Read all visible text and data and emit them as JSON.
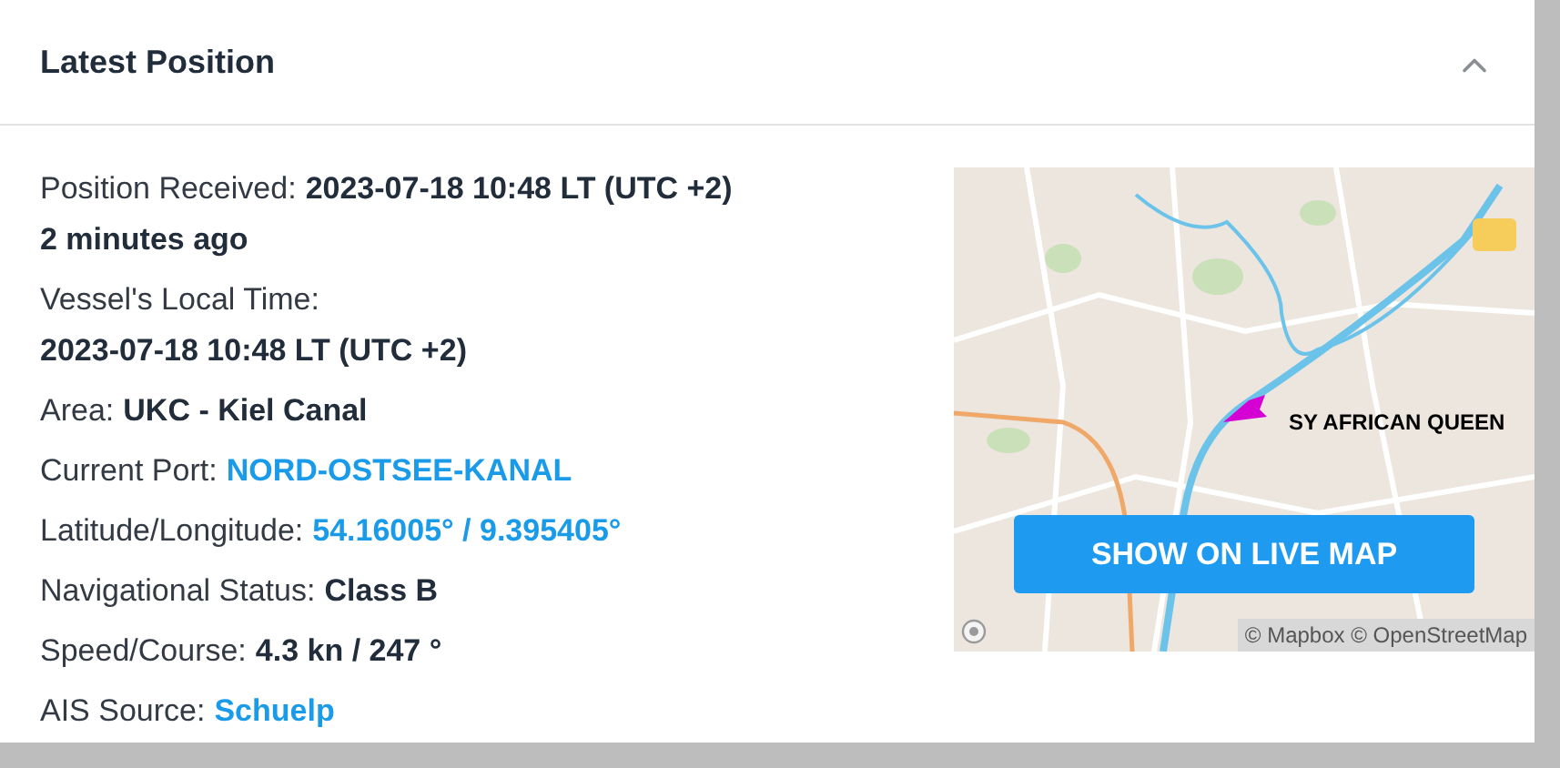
{
  "panel": {
    "title": "Latest Position",
    "expanded": true
  },
  "fields": [
    {
      "label": "Position Received:",
      "value": "2023-07-18 10:48 LT (UTC +2)",
      "kind": "bold",
      "value_below": false,
      "note": "2 minutes ago"
    },
    {
      "label": "Vessel's Local Time:",
      "value": "2023-07-18 10:48 LT (UTC +2)",
      "kind": "bold",
      "value_below": true
    },
    {
      "label": "Area:",
      "value": "UKC - Kiel Canal",
      "kind": "bold",
      "value_below": false
    },
    {
      "label": "Current Port:",
      "value": "NORD-OSTSEE-KANAL",
      "kind": "link",
      "value_below": false
    },
    {
      "label": "Latitude/Longitude:",
      "value": "54.16005° / 9.395405°",
      "kind": "link",
      "value_below": false
    },
    {
      "label": "Navigational Status:",
      "value": "Class B",
      "kind": "bold",
      "value_below": false
    },
    {
      "label": "Speed/Course:",
      "value": "4.3 kn / 247 °",
      "kind": "bold",
      "value_below": false
    },
    {
      "label": "AIS Source:",
      "value": "Schuelp",
      "kind": "link",
      "value_below": false
    }
  ],
  "map": {
    "vessel_label": "SY AFRICAN QUEEN",
    "button": "SHOW ON LIVE MAP",
    "attribution": "© Mapbox © OpenStreetMap"
  }
}
